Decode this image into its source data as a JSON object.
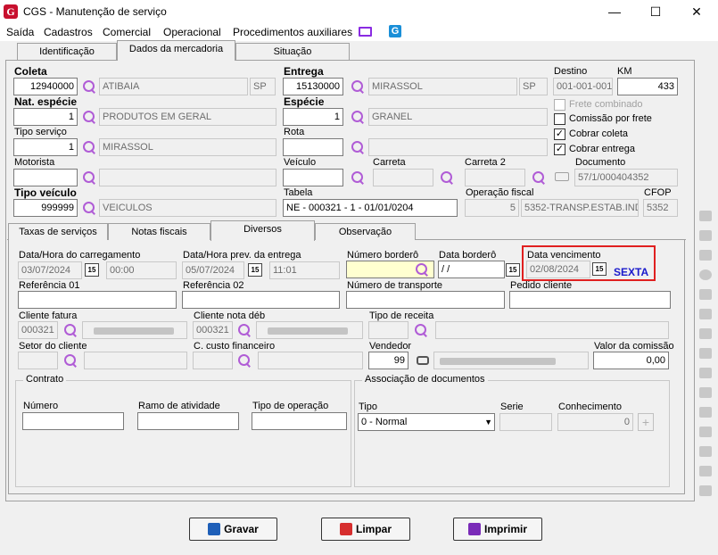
{
  "window": {
    "title": "CGS - Manutenção de serviço",
    "logo": "G",
    "min": "—",
    "max": "☐",
    "close": "✕"
  },
  "menu": [
    "Saída",
    "Cadastros",
    "Comercial",
    "Operacional",
    "Procedimentos auxiliares"
  ],
  "top_tabs": [
    "Identificação",
    "Dados da mercadoria",
    "Situação"
  ],
  "coleta": {
    "label": "Coleta",
    "code": "12940000",
    "city": "ATIBAIA",
    "uf": "SP"
  },
  "entrega": {
    "label": "Entrega",
    "code": "15130000",
    "city": "MIRASSOL",
    "uf": "SP"
  },
  "destino": {
    "label": "Destino",
    "value": "001-001-001"
  },
  "km": {
    "label": "KM",
    "value": "433"
  },
  "nat": {
    "label": "Nat. espécie",
    "code": "1",
    "desc": "PRODUTOS EM GERAL"
  },
  "especie": {
    "label": "Espécie",
    "code": "1",
    "desc": "GRANEL"
  },
  "tipo_servico": {
    "label": "Tipo serviço",
    "code": "1",
    "desc": "MIRASSOL"
  },
  "rota": {
    "label": "Rota"
  },
  "checks": {
    "frete_combinado": "Frete combinado",
    "comissao": "Comissão por frete",
    "cobrar_coleta": "Cobrar coleta",
    "cobrar_entrega": "Cobrar entrega",
    "checked": "✓"
  },
  "motorista": {
    "label": "Motorista"
  },
  "veiculo": {
    "label": "Veículo"
  },
  "carreta": {
    "label": "Carreta"
  },
  "carreta2": {
    "label": "Carreta 2"
  },
  "documento": {
    "label": "Documento",
    "value": "57/1/000404352"
  },
  "tipo_veiculo": {
    "label": "Tipo veículo",
    "code": "999999",
    "desc": "VEICULOS"
  },
  "tabela": {
    "label": "Tabela",
    "value": "NE - 000321 - 1 - 01/01/0204"
  },
  "operacao": {
    "label": "Operação fiscal",
    "code": "5",
    "desc": "5352-TRANSP.ESTAB.IND"
  },
  "cfop": {
    "label": "CFOP",
    "value": "5352"
  },
  "inner_tabs": [
    "Taxas de serviços",
    "Notas fiscais",
    "Diversos",
    "Observação"
  ],
  "diversos": {
    "carregamento": {
      "label": "Data/Hora do carregamento",
      "date": "03/07/2024",
      "time": "00:00"
    },
    "prev_entrega": {
      "label": "Data/Hora prev. da entrega",
      "date": "05/07/2024",
      "time": "11:01"
    },
    "numero_bordero": {
      "label": "Número borderô",
      "value": ""
    },
    "data_bordero": {
      "label": "Data borderô",
      "value": " /  /"
    },
    "vencimento": {
      "label": "Data vencimento",
      "value": "02/08/2024",
      "weekday": "SEXTA"
    },
    "ref1": {
      "label": "Referência 01"
    },
    "ref2": {
      "label": "Referência 02"
    },
    "num_transporte": {
      "label": "Número de transporte"
    },
    "pedido": {
      "label": "Pedido cliente"
    },
    "cliente_fatura": {
      "label": "Cliente fatura",
      "code": "000321"
    },
    "cliente_nota": {
      "label": "Cliente nota déb",
      "code": "000321"
    },
    "tipo_receita": {
      "label": "Tipo de receita"
    },
    "setor": {
      "label": "Setor do cliente"
    },
    "custo": {
      "label": "C. custo financeiro"
    },
    "vendedor": {
      "label": "Vendedor",
      "code": "99"
    },
    "comissao": {
      "label": "Valor da comissão",
      "value": "0,00"
    },
    "calendar_glyph": "15"
  },
  "contrato": {
    "title": "Contrato",
    "numero": "Número",
    "ramo": "Ramo de atividade",
    "tipo_op": "Tipo de operação"
  },
  "assoc": {
    "title": "Associação de documentos",
    "tipo": "Tipo",
    "tipo_value": "0 - Normal",
    "serie": "Serie",
    "conhecimento": "Conhecimento",
    "conhecimento_value": "0",
    "plus": "+"
  },
  "buttons": {
    "gravar": "Gravar",
    "limpar": "Limpar",
    "imprimir": "Imprimir"
  },
  "colors": {
    "highlight": "#e02020",
    "weekday": "#1a1acc",
    "accent": "#b05cd6"
  }
}
